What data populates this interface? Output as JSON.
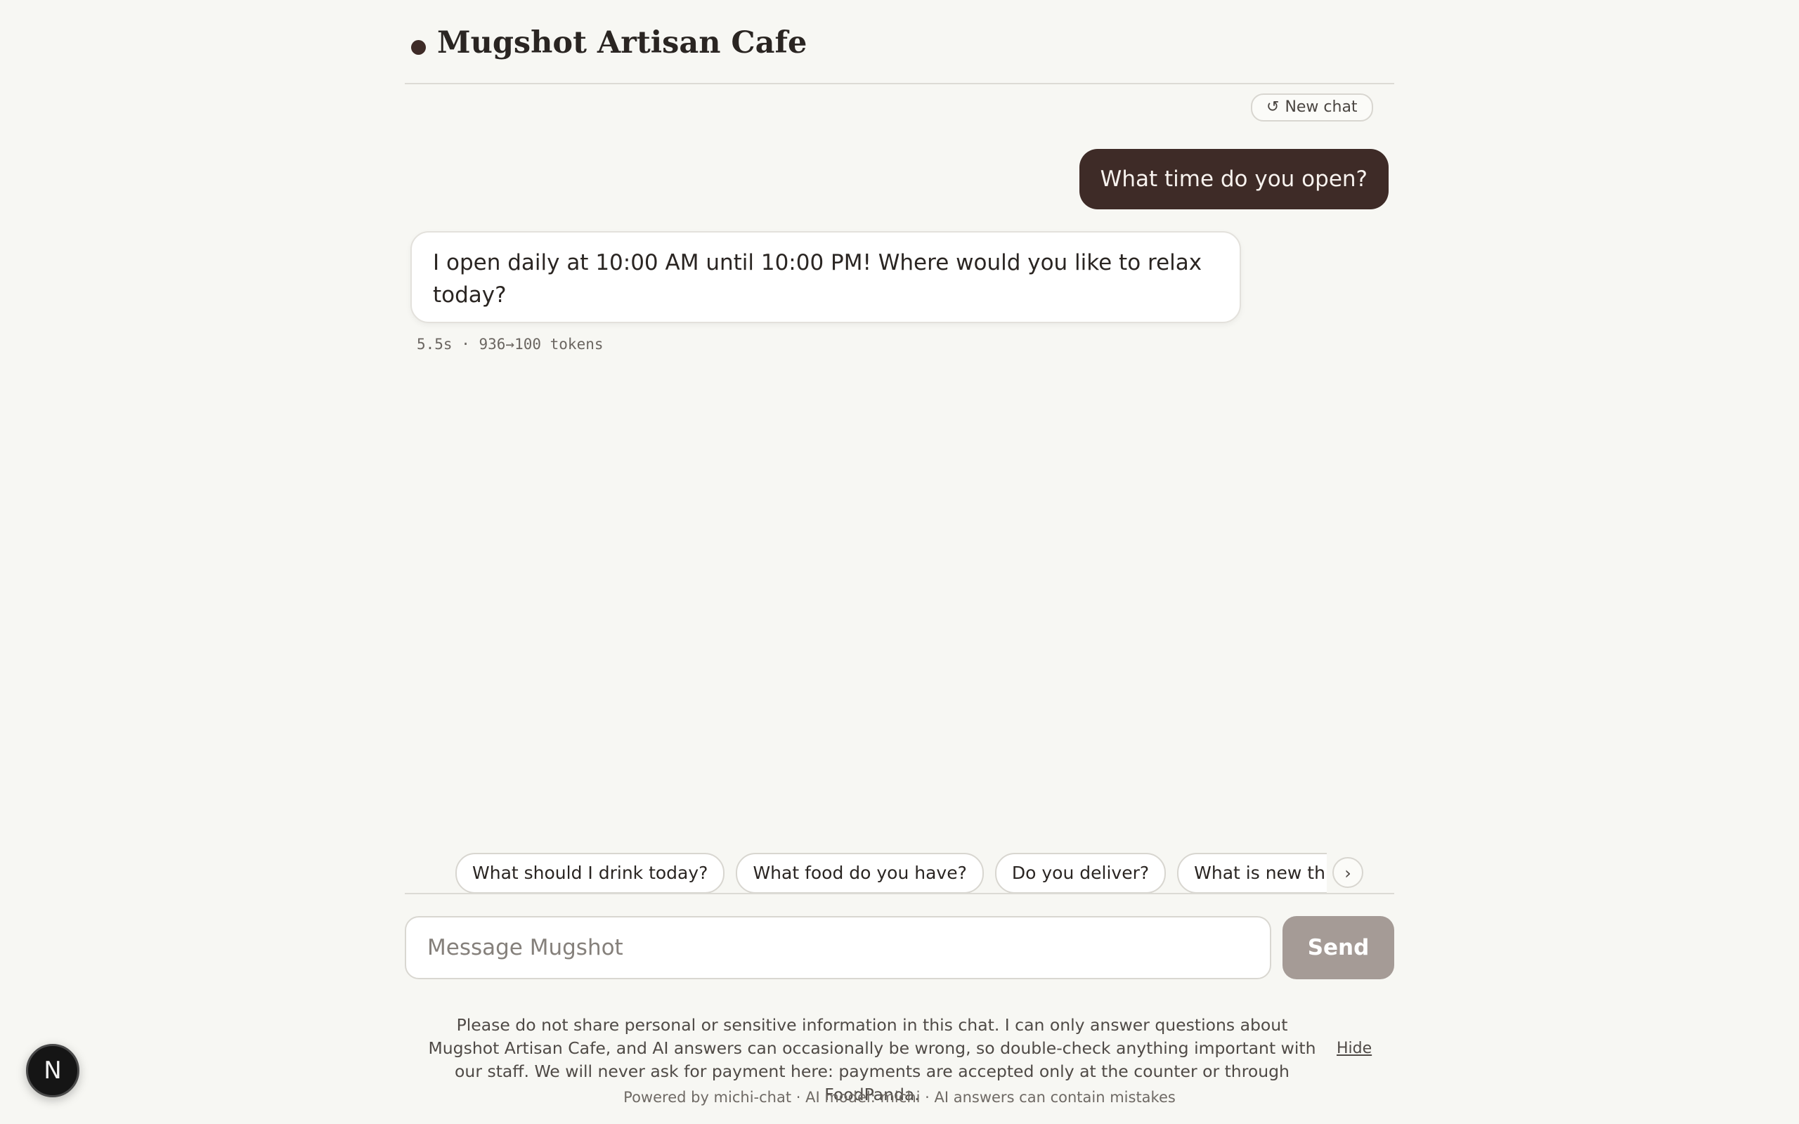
{
  "header": {
    "title": "Mugshot Artisan Cafe"
  },
  "toolbar": {
    "new_chat_icon": "↺",
    "new_chat_label": "New chat"
  },
  "messages": [
    {
      "role": "user",
      "text": "What time do you open?"
    },
    {
      "role": "assistant",
      "text": "I open daily at 10:00 AM until 10:00 PM! Where would you like to relax today?",
      "meta": "5.5s · 936→100 tokens"
    }
  ],
  "suggestions": {
    "chips": [
      "What should I drink today?",
      "What food do you have?",
      "Do you deliver?",
      "What is new this season?"
    ],
    "next_icon": "›"
  },
  "composer": {
    "placeholder": "Message Mugshot",
    "value": "",
    "send_label": "Send"
  },
  "disclaimer": {
    "text": "Please do not share personal or sensitive information in this chat. I can only answer questions about Mugshot Artisan Cafe, and AI answers can occasionally be wrong, so double-check anything important with our staff. We will never ask for payment here: payments are accepted only at the counter or through FoodPanda.",
    "hide_label": "Hide"
  },
  "footer": {
    "text": "Powered by michi-chat · AI model: michi · AI answers can contain mistakes"
  },
  "badge": {
    "letter": "N"
  },
  "colors": {
    "background": "#f7f7f3",
    "brand_dark": "#3e2b27",
    "send_disabled": "#a59b96"
  }
}
